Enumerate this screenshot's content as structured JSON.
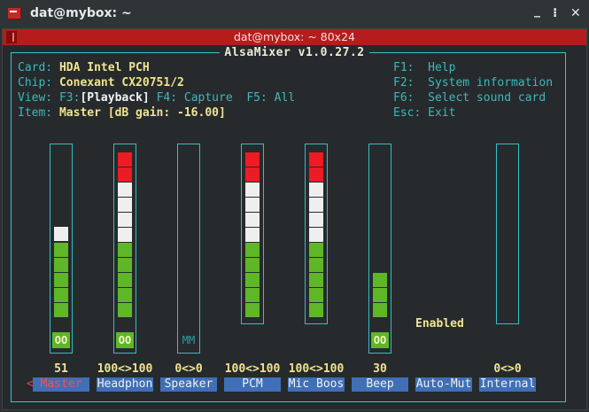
{
  "window": {
    "title": "dat@mybox: ~",
    "minimize_glyph": "_",
    "restore_glyph": "⁝",
    "close_glyph": "✕"
  },
  "terminal": {
    "title": "dat@mybox: ~ 80x24"
  },
  "alsamixer": {
    "title": "AlsaMixer v1.0.27.2",
    "card_label": "Card:",
    "card_value": "HDA Intel PCH",
    "chip_label": "Chip:",
    "chip_value": "Conexant CX20751/2",
    "view_label": "View:",
    "view_f3": "F3:",
    "view_playback": "[Playback]",
    "view_f4": "F4: Capture",
    "view_f5": "F5: All",
    "item_label": "Item:",
    "item_value": "Master [dB gain: -16.00]",
    "help": [
      {
        "key": "F1:",
        "text": "Help"
      },
      {
        "key": "F2:",
        "text": "System information"
      },
      {
        "key": "F6:",
        "text": "Select sound card"
      },
      {
        "key": "Esc:",
        "text": "Exit"
      }
    ],
    "selection_marker": "<",
    "enabled_text": "Enabled",
    "channels": [
      {
        "name": "Master",
        "volume": "51",
        "mute": "OO",
        "selected": true
      },
      {
        "name": "Headphon",
        "volume": "100<>100",
        "mute": "OO",
        "selected": false
      },
      {
        "name": "Speaker",
        "volume": "0<>0",
        "mute": "MM",
        "selected": false
      },
      {
        "name": "PCM",
        "volume": "100<>100",
        "mute": "",
        "selected": false
      },
      {
        "name": "Mic Boos",
        "volume": "100<>100",
        "mute": "",
        "selected": false
      },
      {
        "name": "Beep",
        "volume": "30",
        "mute": "OO",
        "selected": false
      },
      {
        "name": "Auto-Mut",
        "volume": "",
        "mute": "",
        "selected": false
      },
      {
        "name": "Internal",
        "volume": "0<>0",
        "mute": "",
        "selected": false
      }
    ]
  }
}
